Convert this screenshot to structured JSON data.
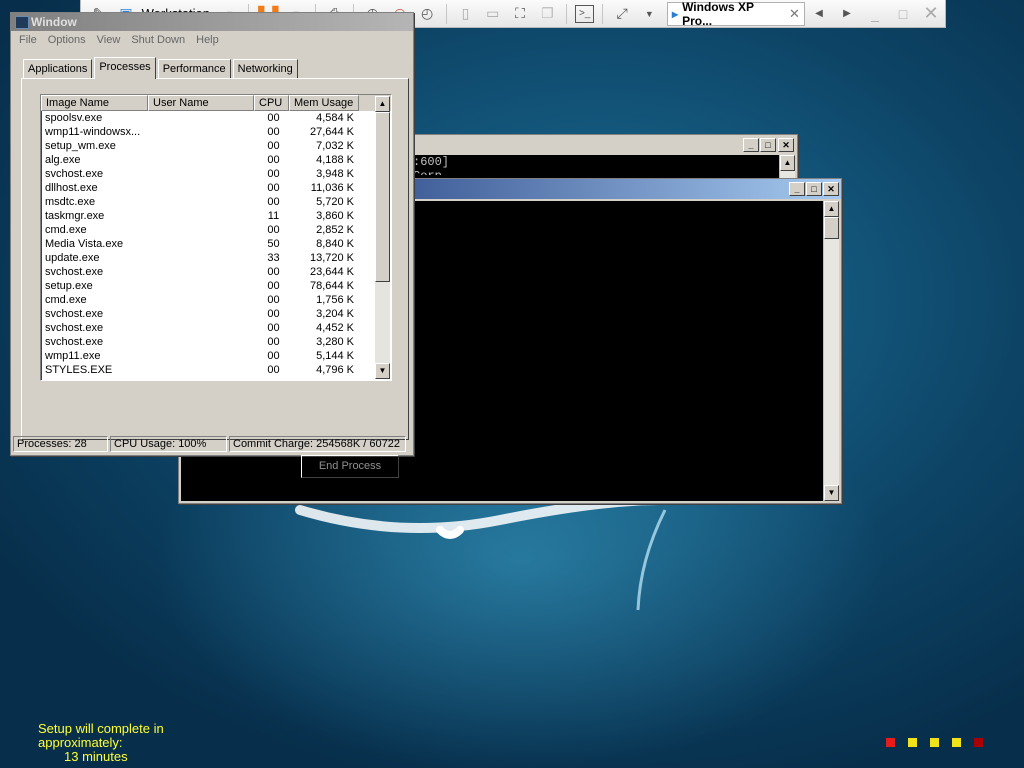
{
  "vm_toolbar": {
    "vm_name": "Workstation",
    "tab_label": "Windows XP Pro...",
    "icons": [
      "pin-icon",
      "workstation-icon",
      "pause-icon",
      "print-icon",
      "snapshot-icon",
      "revert-icon",
      "manage-snapshot-icon",
      "normal-view-icon",
      "quick-switch-icon",
      "full-screen-icon",
      "unity-icon",
      "console-icon",
      "stretch-icon",
      "vm-tab-icon",
      "close-tab-icon",
      "prev-icon",
      "next-icon",
      "minimize-icon",
      "maximize-icon",
      "close-icon"
    ]
  },
  "task_manager": {
    "title": "Window",
    "menu": [
      "File",
      "Options",
      "View",
      "Shut Down",
      "Help"
    ],
    "tabs": [
      "Applications",
      "Processes",
      "Performance",
      "Networking"
    ],
    "active_tab": "Processes",
    "columns": [
      "Image Name",
      "User Name",
      "CPU",
      "Mem Usage"
    ],
    "processes": [
      {
        "name": "spoolsv.exe",
        "user": "",
        "cpu": "00",
        "mem": "4,584 K"
      },
      {
        "name": "wmp11-windowsx...",
        "user": "",
        "cpu": "00",
        "mem": "27,644 K"
      },
      {
        "name": "setup_wm.exe",
        "user": "",
        "cpu": "00",
        "mem": "7,032 K"
      },
      {
        "name": "alg.exe",
        "user": "",
        "cpu": "00",
        "mem": "4,188 K"
      },
      {
        "name": "svchost.exe",
        "user": "",
        "cpu": "00",
        "mem": "3,948 K"
      },
      {
        "name": "dllhost.exe",
        "user": "",
        "cpu": "00",
        "mem": "11,036 K"
      },
      {
        "name": "msdtc.exe",
        "user": "",
        "cpu": "00",
        "mem": "5,720 K"
      },
      {
        "name": "taskmgr.exe",
        "user": "",
        "cpu": "11",
        "mem": "3,860 K"
      },
      {
        "name": "cmd.exe",
        "user": "",
        "cpu": "00",
        "mem": "2,852 K"
      },
      {
        "name": "Media Vista.exe",
        "user": "",
        "cpu": "50",
        "mem": "8,840 K"
      },
      {
        "name": "update.exe",
        "user": "",
        "cpu": "33",
        "mem": "13,720 K"
      },
      {
        "name": "svchost.exe",
        "user": "",
        "cpu": "00",
        "mem": "23,644 K"
      },
      {
        "name": "setup.exe",
        "user": "",
        "cpu": "00",
        "mem": "78,644 K"
      },
      {
        "name": "cmd.exe",
        "user": "",
        "cpu": "00",
        "mem": "1,756 K"
      },
      {
        "name": "svchost.exe",
        "user": "",
        "cpu": "00",
        "mem": "3,204 K"
      },
      {
        "name": "svchost.exe",
        "user": "",
        "cpu": "00",
        "mem": "4,452 K"
      },
      {
        "name": "svchost.exe",
        "user": "",
        "cpu": "00",
        "mem": "3,280 K"
      },
      {
        "name": "wmp11.exe",
        "user": "",
        "cpu": "00",
        "mem": "5,144 K"
      },
      {
        "name": "STYLES.EXE",
        "user": "",
        "cpu": "00",
        "mem": "4,796 K"
      }
    ],
    "end_process_label": "End Process",
    "status": {
      "processes": "Processes: 28",
      "cpu": "CPU Usage: 100%",
      "commit": "Commit Charge: 254568K / 60722"
    }
  },
  "console_back": {
    "text_line1": ":600]",
    "text_line2": "Corp."
  },
  "setup": {
    "line1": "Setup will complete in",
    "line2": "approximately:",
    "line3": "13 minutes"
  },
  "progress_dot_colors": [
    "#e51c1c",
    "#f2e21a",
    "#f2e21a",
    "#f2e21a",
    "#a80000"
  ],
  "colors": {
    "title_active": "#0a246a",
    "setup_text": "#ffff33"
  }
}
